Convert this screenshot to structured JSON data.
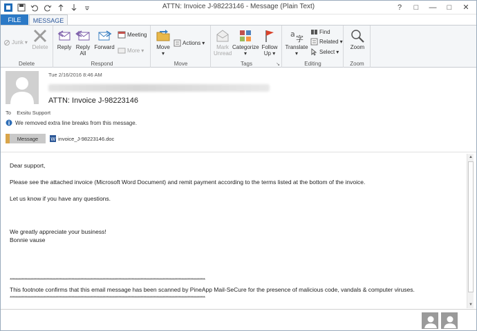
{
  "window": {
    "title": "ATTN: Invoice J-98223146 - Message (Plain Text)",
    "controls": {
      "help": "?",
      "restore": "□",
      "minimize": "—",
      "maximize": "□",
      "close": "✕"
    }
  },
  "quick_access": [
    "save-icon",
    "undo-icon",
    "redo-icon",
    "up-arrow-icon",
    "down-arrow-icon",
    "customize-icon"
  ],
  "tabs": {
    "file": "FILE",
    "message": "MESSAGE"
  },
  "ribbon": {
    "delete_group": {
      "label": "Delete",
      "junk": "Junk",
      "delete": "Delete"
    },
    "respond_group": {
      "label": "Respond",
      "reply": "Reply",
      "reply_all_1": "Reply",
      "reply_all_2": "All",
      "forward": "Forward",
      "meeting": "Meeting",
      "more": "More"
    },
    "move_group": {
      "label": "Move",
      "move": "Move",
      "actions": "Actions"
    },
    "tags_group": {
      "label": "Tags",
      "mark_1": "Mark",
      "mark_2": "Unread",
      "categorize": "Categorize",
      "follow_1": "Follow",
      "follow_2": "Up"
    },
    "editing_group": {
      "label": "Editing",
      "translate": "Translate",
      "find": "Find",
      "related": "Related",
      "select": "Select"
    },
    "zoom_group": {
      "label": "Zoom",
      "zoom": "Zoom"
    }
  },
  "header": {
    "date": "Tue 2/16/2016 8:46 AM",
    "subject": "ATTN: Invoice J-98223146",
    "to_prefix": "To",
    "to_value": "Exsitu Support",
    "info": "We removed extra line breaks from this message.",
    "attachments": {
      "message_tab": "Message",
      "file_name": "invoice_J-98223146.doc"
    }
  },
  "body": {
    "greeting": "Dear support,",
    "para1": "Please see the attached invoice (Microsoft Word Document) and remit payment according to the terms listed at the bottom of the invoice.",
    "para2": "Let us know if you have any questions.",
    "closing1": "We greatly appreciate your business!",
    "closing2": "Bonnie vause",
    "stars": "*************************************************************************************************************************************",
    "footnote": "This footnote confirms that this email message has been scanned by PineApp Mail-SeCure for the presence of malicious code, vandals & computer viruses."
  },
  "colors": {
    "file_tab": "#2b79c6",
    "ribbon_bg": "#f4f6f8",
    "accent": "#2b579a"
  }
}
